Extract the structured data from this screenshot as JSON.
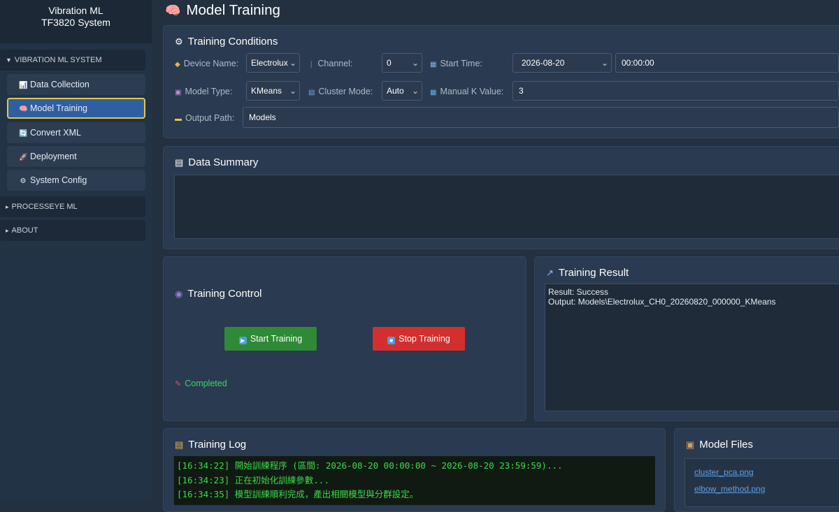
{
  "sidebar": {
    "title_line1": "Vibration ML",
    "title_line2": "TF3820 System",
    "sections": [
      {
        "label": "VIBRATION ML SYSTEM",
        "caret": "▼"
      },
      {
        "label": "PROCESSEYE ML",
        "caret": "▸"
      },
      {
        "label": "ABOUT",
        "caret": "▸"
      }
    ],
    "items": [
      {
        "label": "Data Collection",
        "icon": "📊"
      },
      {
        "label": "Model Training",
        "icon": "🧠"
      },
      {
        "label": "Convert XML",
        "icon": "🔄"
      },
      {
        "label": "Deployment",
        "icon": "🚀"
      },
      {
        "label": "System Config",
        "icon": "⚙"
      }
    ]
  },
  "page": {
    "title": "Model Training",
    "icon": "🧠"
  },
  "conditions": {
    "title": "Training Conditions",
    "device_label": "Device Name:",
    "device_value": "Electrolux",
    "channel_label": "Channel:",
    "channel_value": "0",
    "start_label": "Start Time:",
    "start_date": "2026-08-20",
    "start_time": "00:00:00",
    "model_label": "Model Type:",
    "model_value": "KMeans",
    "cluster_label": "Cluster Mode:",
    "cluster_value": "Auto",
    "k_label": "Manual K Value:",
    "k_value": "3",
    "output_label": "Output Path:",
    "output_value": "Models"
  },
  "summary": {
    "title": "Data Summary"
  },
  "control": {
    "title": "Training Control",
    "start_label": "Start Training",
    "stop_label": "Stop Training",
    "status": "Completed"
  },
  "result": {
    "title": "Training Result",
    "line1": "Result: Success",
    "line2": "Output: Models\\Electrolux_CH0_20260820_000000_KMeans"
  },
  "log": {
    "title": "Training Log",
    "lines": [
      "[16:34:22] 開始訓練程序 (區間: 2026-08-20 00:00:00 ~ 2026-08-20 23:59:59)...",
      "[16:34:23] 正在初始化訓練參數...",
      "[16:34:35] 模型訓練順利完成，產出相關模型與分群設定。"
    ]
  },
  "files": {
    "title": "Model Files",
    "items": [
      "cluster_pca.png",
      "elbow_method.png"
    ]
  },
  "colors": {
    "start_button": "#2e8a35",
    "stop_button": "#d32f2f",
    "status_text": "#3ed46a",
    "log_text": "#3cdb4a",
    "active_border": "#e4c84a"
  }
}
